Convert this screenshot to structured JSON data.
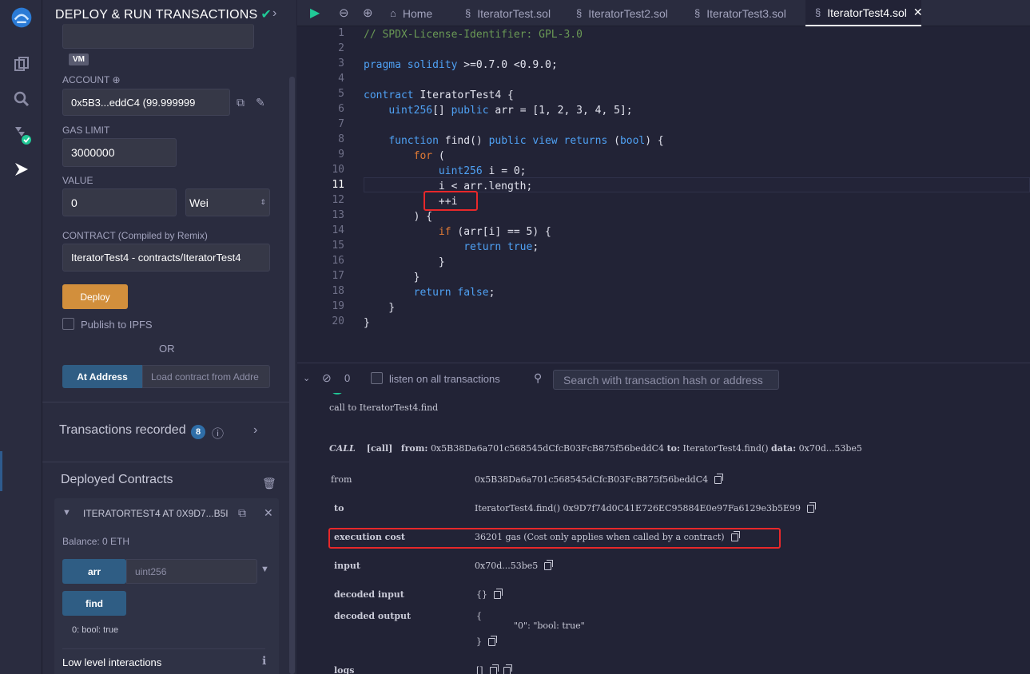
{
  "panel": {
    "title": "DEPLOY & RUN TRANSACTIONS",
    "env_badge": "VM",
    "account_label": "ACCOUNT",
    "account_value": "0x5B3...eddC4 (99.999999",
    "gas_label": "GAS LIMIT",
    "gas_value": "3000000",
    "value_label": "VALUE",
    "value_value": "0",
    "unit_value": "Wei",
    "contract_label": "CONTRACT",
    "contract_note": "(Compiled by Remix)",
    "contract_value": "IteratorTest4 - contracts/IteratorTest4",
    "deploy_button": "Deploy",
    "publish_label": "Publish to IPFS",
    "or_text": "OR",
    "at_address_button": "At Address",
    "at_address_placeholder": "Load contract from Addre",
    "transactions_recorded": "Transactions recorded",
    "transactions_count": "8",
    "deployed_contracts": "Deployed Contracts",
    "instance_name": "ITERATORTEST4 AT 0X9D7...B5I",
    "balance": "Balance: 0 ETH",
    "arr_button": "arr",
    "arr_placeholder": "uint256",
    "find_button": "find",
    "find_result": "0: bool: true",
    "low_level": "Low level interactions"
  },
  "tabs": [
    {
      "label": "Home"
    },
    {
      "label": "IteratorTest.sol"
    },
    {
      "label": "IteratorTest2.sol"
    },
    {
      "label": "IteratorTest3.sol"
    },
    {
      "label": "IteratorTest4.sol"
    }
  ],
  "code_lines": [
    "// SPDX-License-Identifier: GPL-3.0",
    "",
    "pragma solidity >=0.7.0 <0.9.0;",
    "",
    "contract IteratorTest4 {",
    "    uint256[] public arr = [1, 2, 3, 4, 5];",
    "",
    "    function find() public view returns (bool) {",
    "        for (",
    "            uint256 i = 0;",
    "            i < arr.length;",
    "            ++i",
    "        ) {",
    "            if (arr[i] == 5) {",
    "                return true;",
    "            }",
    "        }",
    "        return false;",
    "    }",
    "}"
  ],
  "terminal": {
    "count": "0",
    "listen_label": "listen on all transactions",
    "search_placeholder": "Search with transaction hash or address",
    "call_line": "call to IteratorTest4.find",
    "call_tag": "CALL",
    "call_kind": "[call]",
    "from_key": "from:",
    "from_val": "0x5B38Da6a701c568545dCfcB03FcB875f56beddC4",
    "to_key": "to:",
    "to_val": "IteratorTest4.find()",
    "data_key": "data:",
    "data_val": "0x70d...53be5",
    "rows": {
      "from_label": "from",
      "from_value": "0x5B38Da6a701c568545dCfcB03FcB875f56beddC4",
      "to_label": "to",
      "to_value": "IteratorTest4.find() 0x9D7f74d0C41E726EC95884E0e97Fa6129e3b5E99",
      "exec_label": "execution cost",
      "exec_value": "36201 gas (Cost only applies when called by a contract)",
      "input_label": "input",
      "input_value": "0x70d...53be5",
      "decoded_input_label": "decoded input",
      "decoded_input_value": "{}",
      "decoded_output_label": "decoded output",
      "decoded_output_open": "{",
      "decoded_output_body": "\"0\": \"bool: true\"",
      "decoded_output_close": "}",
      "logs_label": "logs",
      "logs_value": "[]"
    }
  }
}
